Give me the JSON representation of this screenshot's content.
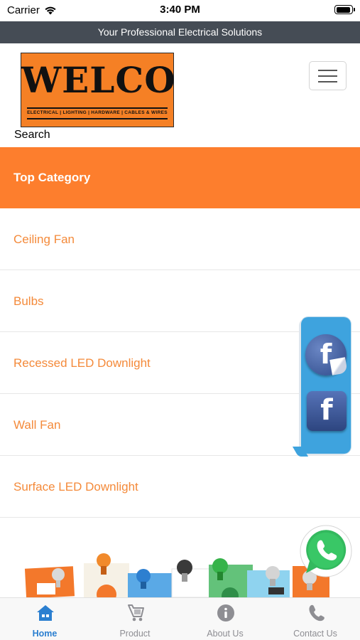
{
  "status_bar": {
    "carrier": "Carrier",
    "time": "3:40 PM"
  },
  "tagline": "Your Professional Electrical Solutions",
  "logo": {
    "name": "WELCO",
    "tagline": "ELECTRICAL | LIGHTING | HARDWARE | CABLES & WIRES"
  },
  "search": {
    "label": "Search"
  },
  "categories": {
    "title": "Top Category",
    "items": [
      {
        "label": "Ceiling Fan"
      },
      {
        "label": "Bulbs"
      },
      {
        "label": "Recessed LED Downlight"
      },
      {
        "label": "Wall Fan"
      },
      {
        "label": "Surface LED Downlight"
      }
    ]
  },
  "social": {
    "facebook_letter": "f"
  },
  "tab_bar": {
    "items": [
      {
        "label": "Home",
        "icon": "home-icon",
        "active": true
      },
      {
        "label": "Product",
        "icon": "cart-icon",
        "active": false
      },
      {
        "label": "About Us",
        "icon": "info-icon",
        "active": false
      },
      {
        "label": "Contact Us",
        "icon": "phone-icon",
        "active": false
      }
    ]
  },
  "colors": {
    "accent": "#fd7e2d",
    "category_text": "#f48a3a",
    "tagline_bg": "#454c55",
    "tab_active": "#2b7fd0",
    "tab_inactive": "#8e8e93",
    "facebook": "#3b5998",
    "whatsapp": "#25d366"
  }
}
